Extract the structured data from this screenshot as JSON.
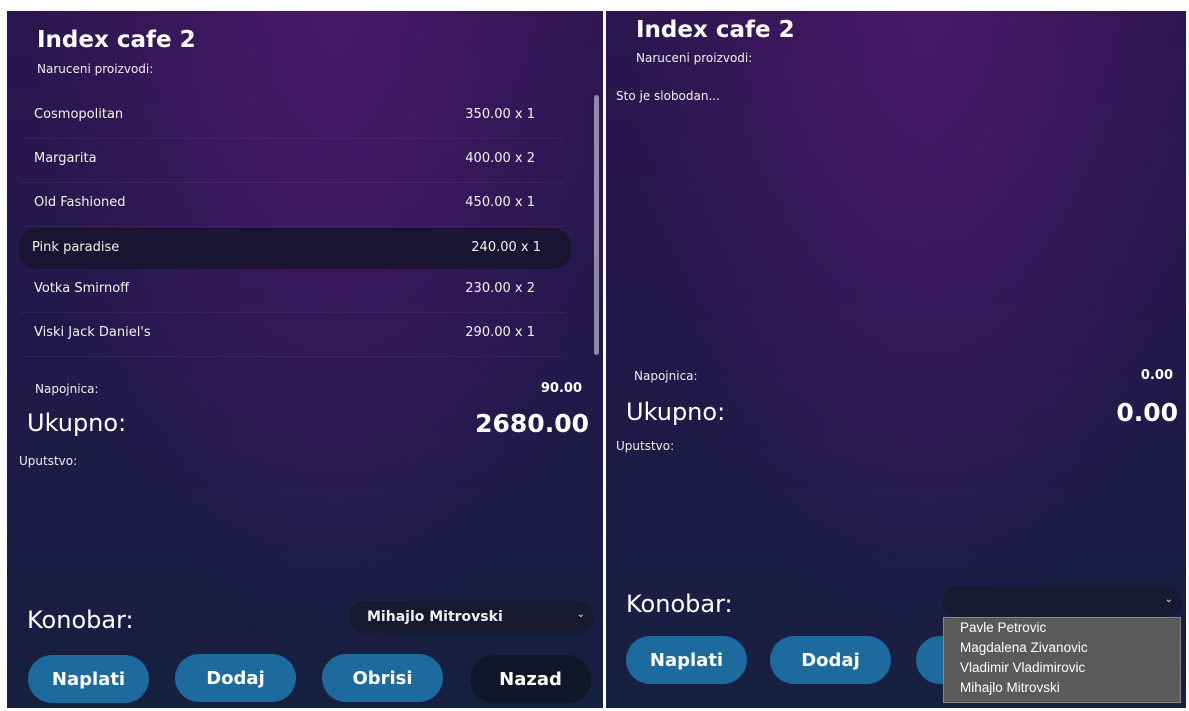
{
  "left": {
    "title": "Index cafe 2",
    "subtitle": "Naruceni proizvodi:",
    "items": [
      {
        "name": "Cosmopolitan",
        "price": "350.00 x 1"
      },
      {
        "name": "Margarita",
        "price": "400.00 x 2"
      },
      {
        "name": "Old Fashioned",
        "price": "450.00 x 1"
      },
      {
        "name": "Pink paradise",
        "price": "240.00 x 1"
      },
      {
        "name": "Votka Smirnoff",
        "price": "230.00 x 2"
      },
      {
        "name": "Viski Jack Daniel's",
        "price": "290.00 x 1"
      }
    ],
    "selected_index": 3,
    "tip_label": "Napojnica:",
    "tip_value": "90.00",
    "total_label": "Ukupno:",
    "total_value": "2680.00",
    "instructions_label": "Uputstvo:",
    "waiter_label": "Konobar:",
    "waiter_selected": "Mihajlo Mitrovski",
    "buttons": {
      "pay": "Naplati",
      "add": "Dodaj",
      "delete": "Obrisi",
      "back": "Nazad"
    }
  },
  "right": {
    "title": "Index cafe 2",
    "subtitle": "Naruceni proizvodi:",
    "empty_message": "Sto je slobodan...",
    "tip_label": "Napojnica:",
    "tip_value": "0.00",
    "total_label": "Ukupno:",
    "total_value": "0.00",
    "instructions_label": "Uputstvo:",
    "waiter_label": "Konobar:",
    "waiter_selected": "",
    "waiter_options": [
      "Pavle Petrovic",
      "Magdalena Zivanovic",
      "Vladimir Vladimirovic",
      "Mihajlo Mitrovski"
    ],
    "buttons": {
      "pay": "Naplati",
      "add": "Dodaj"
    }
  },
  "icons": {
    "select_chevron": "chevron-down-icon"
  },
  "colors": {
    "button_blue": "#1d6b9e",
    "button_dark": "#11162a",
    "select_bg": "#171a2e",
    "dropdown_bg": "#5a5a5a"
  }
}
